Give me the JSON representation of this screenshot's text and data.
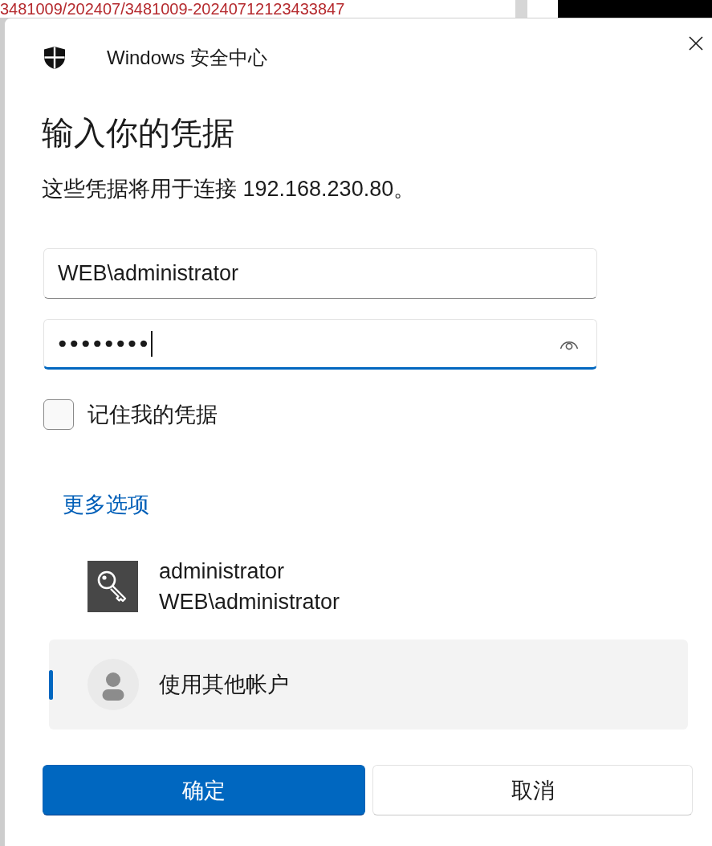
{
  "background": {
    "text": "3481009/202407/3481009-20240712123433847"
  },
  "dialog": {
    "app_title": "Windows 安全中心",
    "heading": "输入你的凭据",
    "description": "这些凭据将用于连接 192.168.230.80。"
  },
  "fields": [
    {
      "kind": "text",
      "value": "WEB\\administrator",
      "focused": false
    },
    {
      "kind": "password",
      "value": "●●●●●●●●",
      "focused": true
    }
  ],
  "remember": {
    "label": "记住我的凭据",
    "checked": false
  },
  "more_options": {
    "label": "更多选项"
  },
  "accounts": [
    {
      "kind": "credential",
      "name": "administrator",
      "detail": "WEB\\administrator",
      "selected": false
    },
    {
      "kind": "other",
      "name": "使用其他帐户",
      "selected": true
    }
  ],
  "buttons": [
    {
      "kind": "primary",
      "label": "确定"
    },
    {
      "kind": "secondary",
      "label": "取消"
    }
  ]
}
